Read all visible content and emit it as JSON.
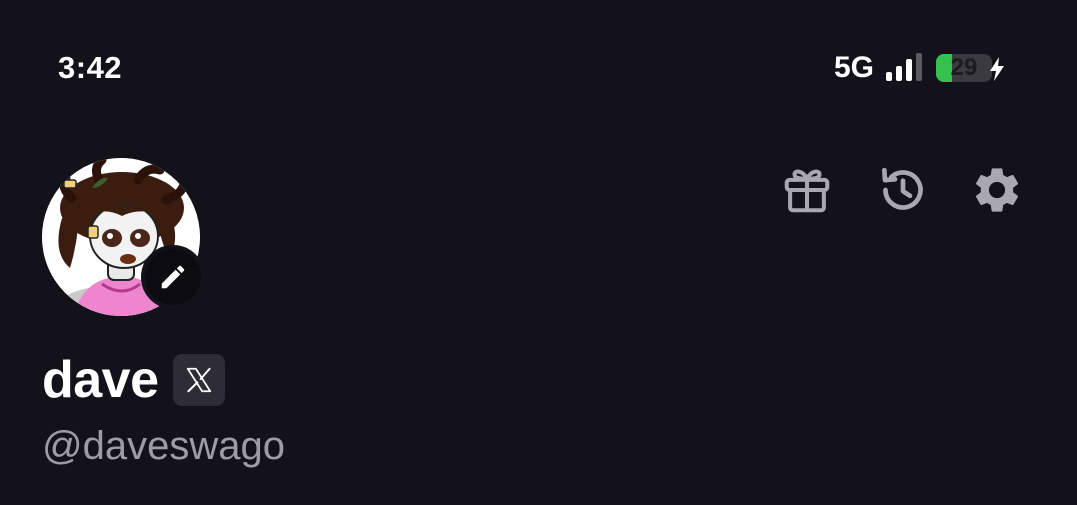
{
  "status_bar": {
    "time": "3:42",
    "network": "5G",
    "battery_percent": "29",
    "battery_level": 0.29,
    "charging": true,
    "battery_color": "#33c24d"
  },
  "header": {
    "actions": [
      {
        "icon": "gift-icon"
      },
      {
        "icon": "history-icon"
      },
      {
        "icon": "gear-icon"
      }
    ]
  },
  "profile": {
    "display_name": "dave",
    "username": "@daveswago",
    "linked_account_icon": "x-logo-icon",
    "avatar_icon": "avatar-illustration",
    "edit_icon": "pencil-icon"
  },
  "colors": {
    "background": "#13121b",
    "icon": "#a9a8b0",
    "handle": "#9d9ba6"
  }
}
